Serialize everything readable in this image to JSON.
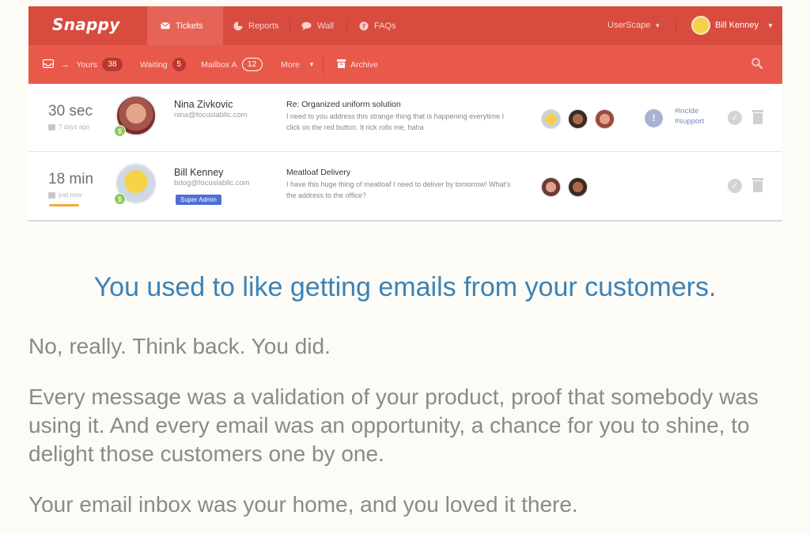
{
  "app": {
    "logo": "Snappy",
    "nav": {
      "tabs": [
        {
          "label": "Tickets",
          "icon": "envelope-icon",
          "active": true
        },
        {
          "label": "Reports",
          "icon": "pie-chart-icon"
        },
        {
          "label": "Wall",
          "icon": "chat-bubble-icon"
        },
        {
          "label": "FAQs",
          "icon": "question-icon"
        }
      ],
      "org": "UserScape",
      "user": "Bill Kenney"
    },
    "subnav": {
      "yours_label": "Yours",
      "yours_count": "38",
      "waiting_label": "Waiting",
      "waiting_count": "5",
      "mailbox_label": "Mailbox A",
      "mailbox_count": "12",
      "more_label": "More",
      "archive_label": "Archive"
    },
    "tickets": [
      {
        "time": "30 sec",
        "ago": "7 days ago",
        "name": "Nina Zivkovic",
        "email": "nina@focuslabllc.com",
        "subject": "Re: Organized uniform solution",
        "preview": "I need to you address this strange thing that is happening everytime I click on the red button. It rick rolls me, haha",
        "tags": [
          "#inclde",
          "#support"
        ]
      },
      {
        "time": "18 min",
        "ago": "just now",
        "name": "Bill Kenney",
        "email": "bdog@focuslabllc.com",
        "badge": "Super Admin",
        "subject": "Meatloaf Delivery",
        "preview": "I have this huge thing of meatloaf I need to deliver by tomorrow! What's the address to the office?"
      }
    ],
    "colors": {
      "topbar": "#d84b3f",
      "subbar": "#e8594b",
      "accent": "#3b82b7"
    }
  },
  "copy": {
    "headline": "You used to like getting emails from your customers.",
    "p1": "No, really. Think back. You did.",
    "p2": "Every message was a validation of your product, proof that somebody was using it. And every email was an opportunity, a chance for you to shine, to delight those customers one by one.",
    "p3": "Your email inbox was your home, and you loved it there."
  }
}
